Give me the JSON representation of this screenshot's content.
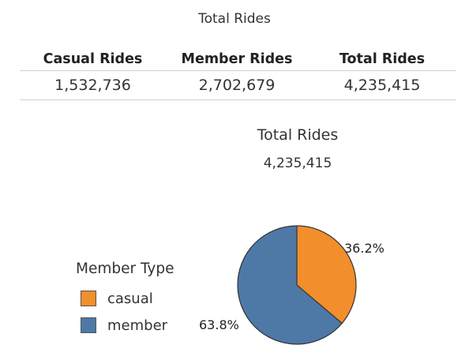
{
  "sheet_title": "Total Rides",
  "table": {
    "headers": [
      "Casual Rides",
      "Member Rides",
      "Total Rides"
    ],
    "values": [
      "1,532,736",
      "2,702,679",
      "4,235,415"
    ]
  },
  "pie": {
    "title": "Total Rides",
    "total": "4,235,415"
  },
  "chart_data": {
    "type": "pie",
    "title": "Total Rides",
    "categories": [
      "casual",
      "member"
    ],
    "values": [
      1532736,
      2702679
    ],
    "labels": [
      "36.2%",
      "63.8%"
    ],
    "colors": [
      "#f28e2b",
      "#4e79a7"
    ],
    "legend_title": "Member Type",
    "legend_placement": "left"
  }
}
